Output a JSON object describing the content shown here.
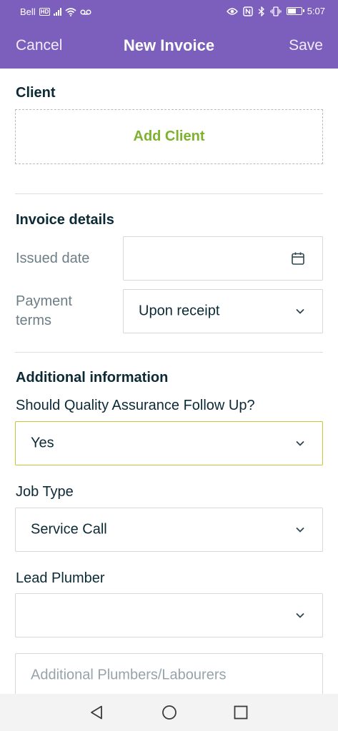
{
  "status_bar": {
    "carrier": "Bell",
    "carrier_badge": "HD",
    "time": "5:07",
    "battery_percent": 65,
    "icons": [
      "signal-icon",
      "wifi-icon",
      "voicemail-icon",
      "eye-icon",
      "nfc-icon",
      "bluetooth-icon",
      "vibrate-icon",
      "battery-icon"
    ]
  },
  "header": {
    "cancel_label": "Cancel",
    "title": "New Invoice",
    "save_label": "Save"
  },
  "client_section": {
    "title": "Client",
    "add_client_label": "Add Client"
  },
  "invoice_details": {
    "title": "Invoice details",
    "issued_date_label": "Issued date",
    "issued_date_value": "",
    "payment_terms_label_line1": "Payment",
    "payment_terms_label_line2": "terms",
    "payment_terms_value": "Upon receipt"
  },
  "additional_information": {
    "title": "Additional information",
    "qa_label": "Should Quality Assurance Follow Up?",
    "qa_value": "Yes",
    "job_type_label": "Job Type",
    "job_type_value": "Service Call",
    "lead_plumber_label": "Lead Plumber",
    "lead_plumber_value": "",
    "additional_plumbers_placeholder": "Additional Plumbers/Labourers"
  },
  "colors": {
    "header_bg": "#7c5fbd",
    "accent_green": "#7db32c",
    "focus_border": "#c9c43d"
  }
}
